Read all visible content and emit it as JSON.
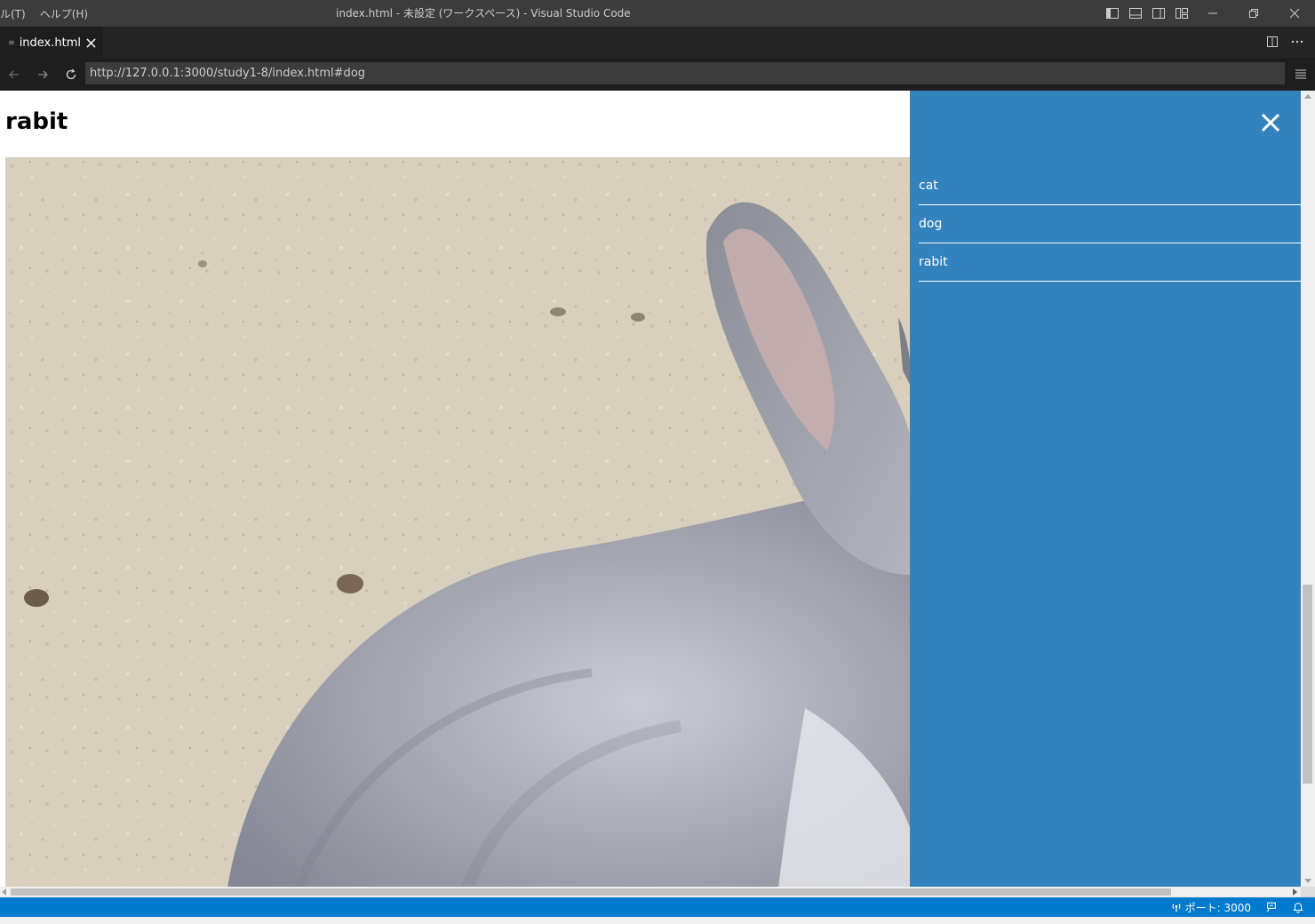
{
  "titlebar": {
    "menu_items": [
      "ル(T)",
      "ヘルプ(H)"
    ],
    "window_title": "index.html - 未設定 (ワークスペース) - Visual Studio Code"
  },
  "tabs": [
    {
      "label": "index.html",
      "icon": "preview-icon"
    }
  ],
  "browser": {
    "url": "http://127.0.0.1:3000/study1-8/index.html#dog"
  },
  "page": {
    "heading": "rabit",
    "image_subject": "rabbit-photo"
  },
  "sidenav": {
    "items": [
      {
        "label": "cat"
      },
      {
        "label": "dog"
      },
      {
        "label": "rabit"
      }
    ],
    "background": "#3282be"
  },
  "statusbar": {
    "port_label": "ポート: 3000",
    "color": "#007acc"
  }
}
